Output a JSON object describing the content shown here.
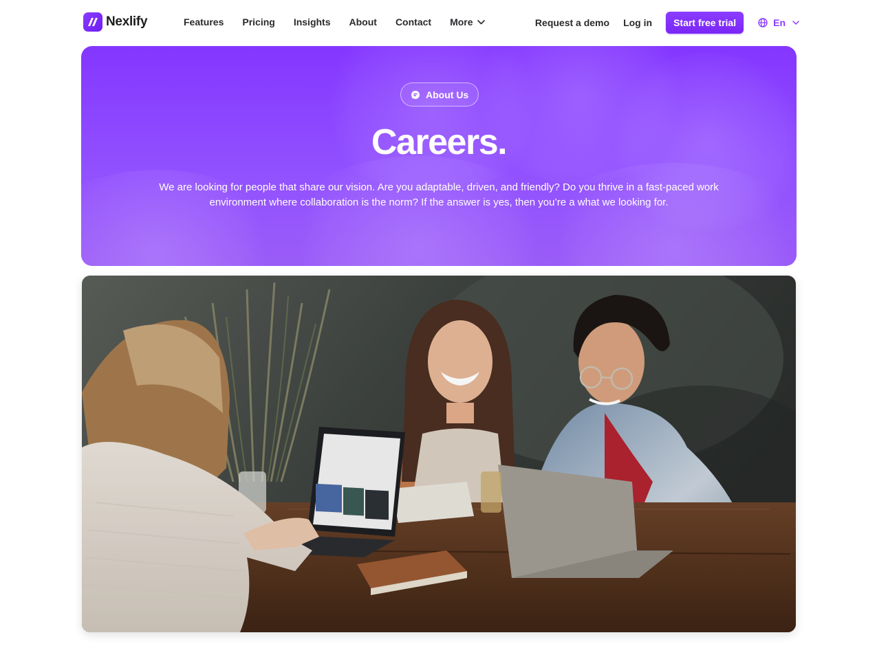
{
  "brand": {
    "name": "Nexlify",
    "accent": "#8a3cff"
  },
  "nav": {
    "links": [
      {
        "label": "Features"
      },
      {
        "label": "Pricing"
      },
      {
        "label": "Insights"
      },
      {
        "label": "About"
      },
      {
        "label": "Contact"
      },
      {
        "label": "More"
      }
    ],
    "request_demo": "Request a demo",
    "login": "Log in",
    "cta": "Start free trial",
    "language": "En"
  },
  "hero": {
    "badge": "About Us",
    "title": "Careers.",
    "description": "We are looking for people that share our vision. Are you adaptable, driven, and friendly? Do you thrive in a fast-paced work environment where collaboration is the norm? If the answer is yes, then you’re a what we looking for.",
    "background_color": "#8a3cff"
  },
  "photo": {
    "icon": "team-photo"
  }
}
